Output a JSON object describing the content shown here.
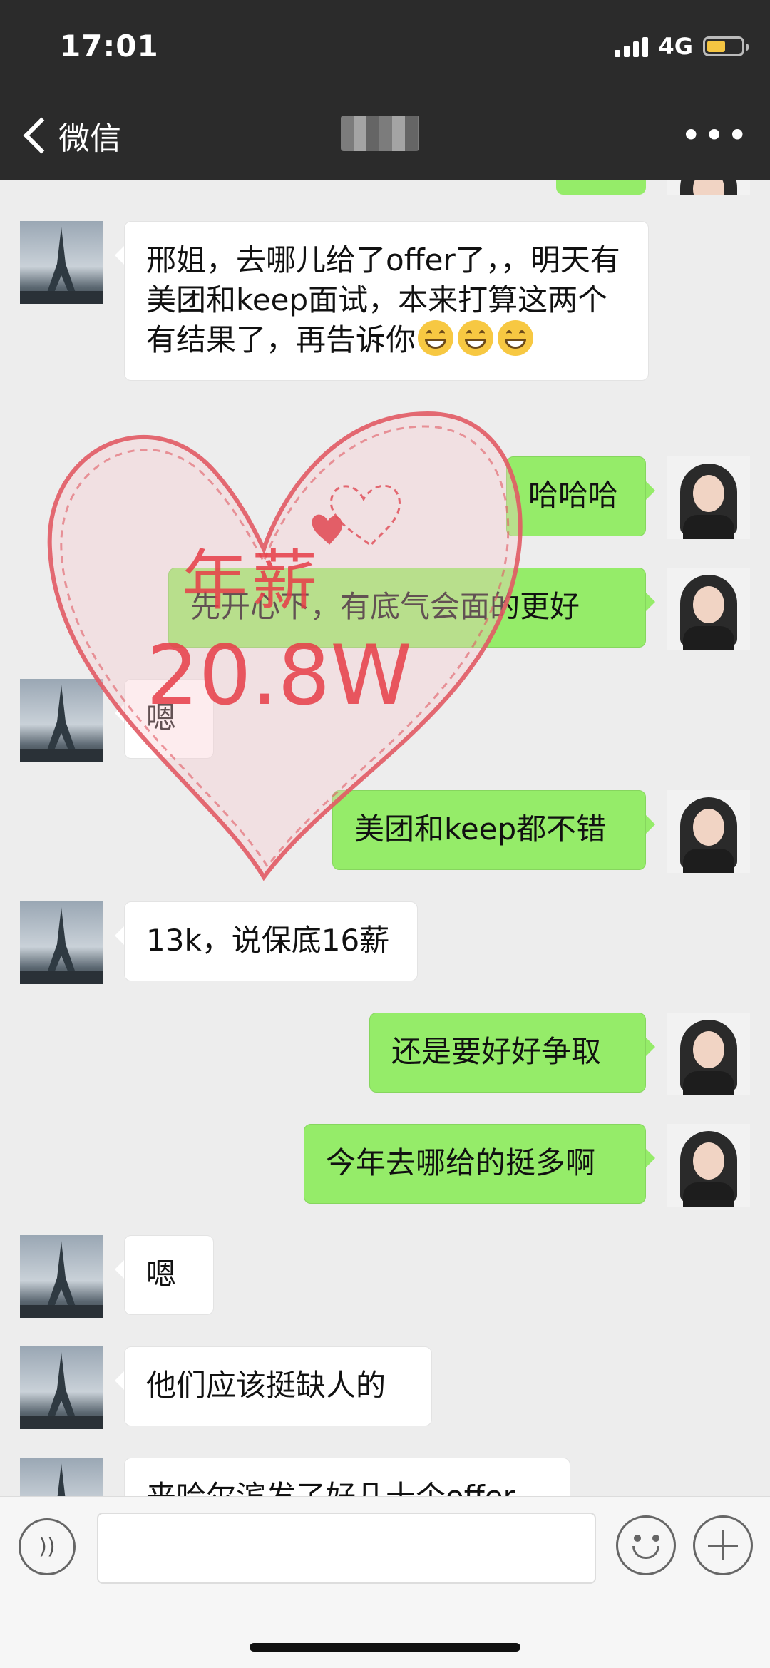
{
  "status_bar": {
    "time": "17:01",
    "network": "4G"
  },
  "header": {
    "back_label": "微信",
    "more_label": "•••"
  },
  "messages": [
    {
      "side": "in",
      "text_parts": [
        "邢姐，去哪儿给了offer了，，明天有美团和keep面试，本来打算这两个有结果了，再告诉你"
      ],
      "emoji_count": 3
    },
    {
      "side": "out",
      "text": "哈哈哈"
    },
    {
      "side": "out",
      "text": "先开心下，有底气会面的更好"
    },
    {
      "side": "in",
      "text": "嗯"
    },
    {
      "side": "out",
      "text": "美团和keep都不错"
    },
    {
      "side": "in",
      "text": "13k，说保底16薪"
    },
    {
      "side": "out",
      "text": "还是要好好争取"
    },
    {
      "side": "out",
      "text": "今年去哪给的挺多啊"
    },
    {
      "side": "in",
      "text": "嗯"
    },
    {
      "side": "in",
      "text": "他们应该挺缺人的"
    },
    {
      "side": "in",
      "text": "来哈尔滨发了好几十个offer"
    }
  ],
  "watermark": {
    "line1": "年薪",
    "line2": "20.8W",
    "color": "#e63c46"
  },
  "input_bar": {
    "placeholder": ""
  }
}
